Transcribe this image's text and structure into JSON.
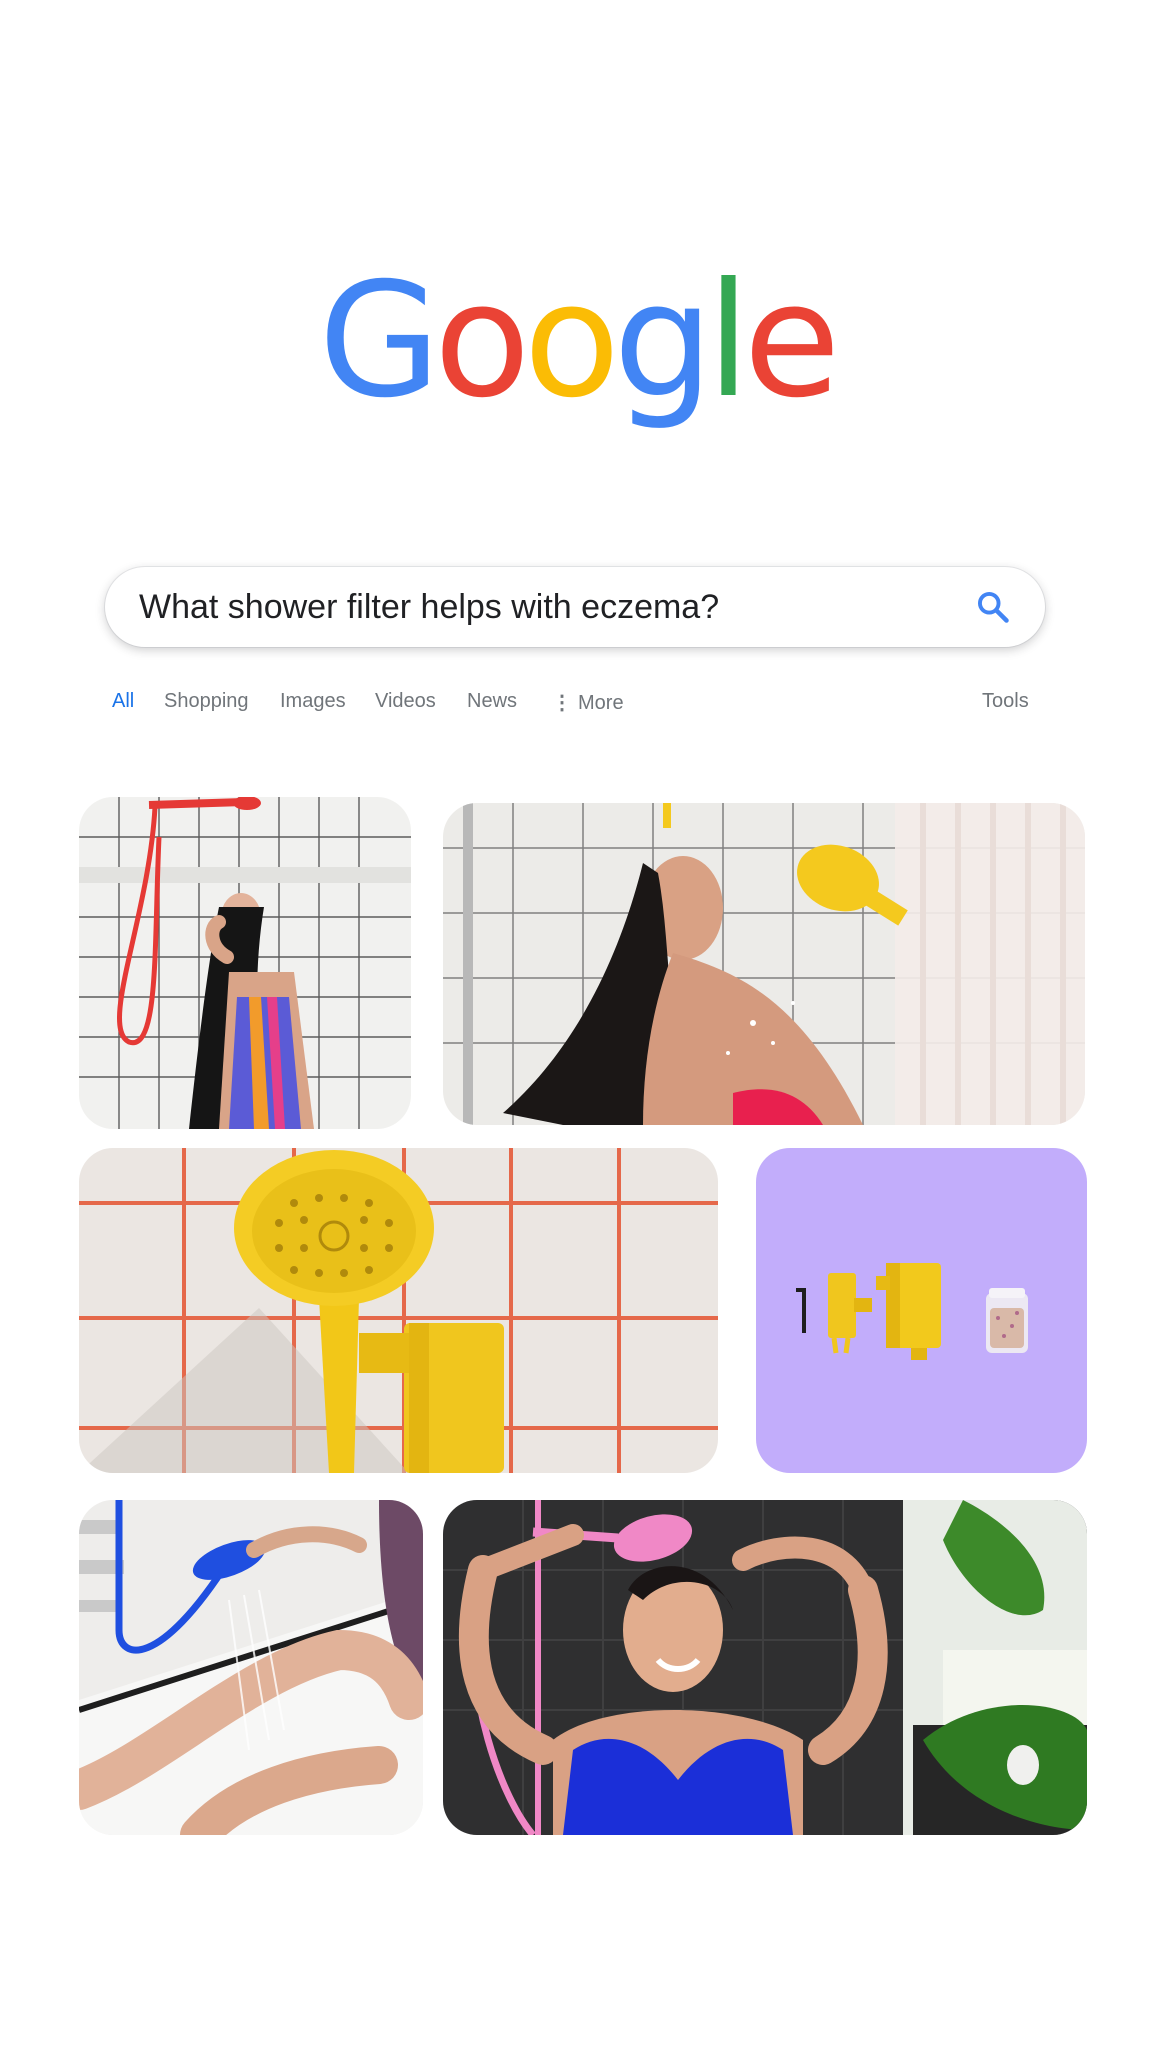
{
  "logo": {
    "letters": [
      "G",
      "o",
      "o",
      "g",
      "l",
      "e"
    ],
    "colors": [
      "#4285F4",
      "#EA4335",
      "#FBBC05",
      "#4285F4",
      "#34A853",
      "#EA4335"
    ]
  },
  "search": {
    "query": "What shower filter helps with eczema?",
    "icon": "search-icon"
  },
  "tabs": {
    "all": "All",
    "shopping": "Shopping",
    "images": "Images",
    "videos": "Videos",
    "news": "News",
    "more": "More",
    "tools": "Tools"
  },
  "colors": {
    "active_tab": "#1a73e8",
    "inactive_tab": "#70757a",
    "accent_yellow": "#f4c91e",
    "accent_purple": "#c2adfb"
  },
  "images": [
    {
      "subject": "woman in striped swimsuit under red shower head"
    },
    {
      "subject": "woman with wet hair under yellow shower head"
    },
    {
      "subject": "yellow shower head with filter on tiled wall"
    },
    {
      "subject": "yellow shower filter parts on purple background"
    },
    {
      "subject": "legs under blue hand shower in bathtub"
    },
    {
      "subject": "smiling woman under pink shower head"
    }
  ]
}
